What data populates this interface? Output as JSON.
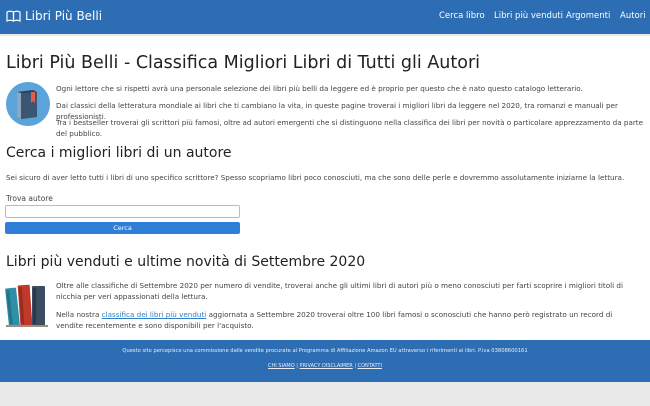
{
  "navbar": {
    "brand": "Libri Più Belli",
    "links": [
      "Cerca libro",
      "Libri più venduti",
      "Argomenti",
      "Autori"
    ]
  },
  "hero": {
    "title": "Libri Più Belli - Classifica Migliori Libri di Tutti gli Autori",
    "paragraphs": [
      "Ogni lettore che si rispetti avrà una personale selezione dei libri più belli da leggere ed è proprio per questo che è nato questo catalogo letterario.",
      "Dai classici della letteratura mondiale ai libri che ti cambiano la vita, in queste pagine troverai i migliori libri da leggere nel 2020, tra romanzi e manuali per professionisti.",
      "Tra i bestseller troverai gli scrittori più famosi, oltre ad autori emergenti che si distinguono nella classifica dei libri per novità o particolare apprezzamento da parte del pubblico."
    ]
  },
  "search": {
    "heading": "Cerca i migliori libri di un autore",
    "description": "Sei sicuro di aver letto tutti i libri di uno specifico scrittore? Spesso scopriamo libri poco conosciuti, ma che sono delle perle e dovremmo assolutamente iniziarne la lettura.",
    "label": "Trova autore",
    "input_value": "",
    "button": "Cerca"
  },
  "bestsellers": {
    "heading": "Libri più venduti e ultime novità di Settembre 2020",
    "paragraph1": "Oltre alle classifiche di Settembre 2020 per numero di vendite, troverai anche gli ultimi libri di autori più o meno conosciuti per farti scoprire i migliori titoli di nicchia per veri appassionati della lettura.",
    "p2_before": "Nella nostra ",
    "p2_link": "classifica dei libri più venduti",
    "p2_after": " aggiornata a Settembre 2020 troverai oltre 100 libri famosi o sconosciuti che hanno però registrato un record di vendite recentemente e sono disponibili per l'acquisto."
  },
  "footer": {
    "disclaimer": "Questo sito percepisce una commissione dalle vendite procurate al Programma di Affiliazione Amazon EU attraverso i riferimenti ai libri. P.iva 03808600161",
    "links": [
      "CHI SIAMO",
      "PRIVACY DISCLAIMER",
      "CONTATTI"
    ],
    "separator": "|"
  },
  "colors": {
    "primary": "#2d6db3",
    "button": "#2f7ed8",
    "link": "#2f7ec4"
  },
  "icons": {
    "brand": "open-book-icon",
    "hero": "book-circle-icon",
    "bestsellers": "stacked-books-icon"
  }
}
